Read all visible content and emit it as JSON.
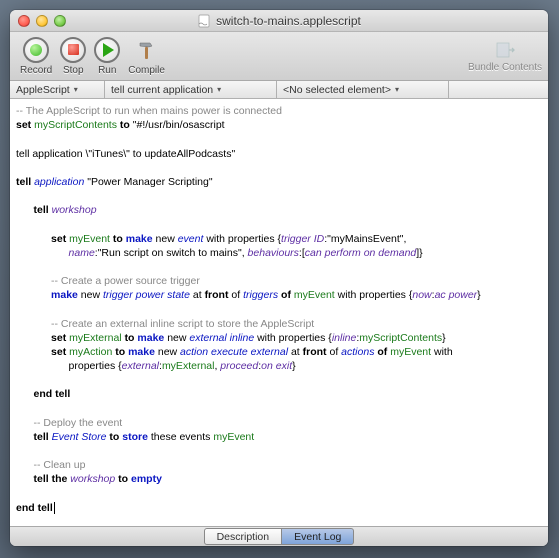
{
  "window": {
    "title": "switch-to-mains.applescript"
  },
  "toolbar": {
    "record": "Record",
    "stop": "Stop",
    "run": "Run",
    "compile": "Compile",
    "bundle": "Bundle Contents"
  },
  "navbar": {
    "lang": "AppleScript",
    "target": "tell current application",
    "element": "<No selected element>"
  },
  "code": {
    "l1_cmt": "-- The AppleScript to run when mains power is connected",
    "l2_a": "set",
    "l2_b": "myScriptContents",
    "l2_c": "to",
    "l2_d": "\"#!/usr/bin/osascript",
    "l3": "",
    "l4": "tell application \\\"iTunes\\\" to updateAllPodcasts\"",
    "l5": "",
    "l6_a": "tell",
    "l6_b": "application",
    "l6_c": "\"Power Manager Scripting\"",
    "l7": "",
    "l8_a": "tell",
    "l8_b": "workshop",
    "l9": "",
    "l10_a": "set",
    "l10_b": "myEvent",
    "l10_c": "to",
    "l10_d": "make",
    "l10_e": "new",
    "l10_f": "event",
    "l10_g": "with properties",
    "l10_h": "{",
    "l10_i": "trigger ID",
    "l10_j": ":\"myMainsEvent\",",
    "l11_a": "name",
    "l11_b": ":\"Run script on switch to mains\",",
    "l11_c": "behaviours",
    "l11_d": ":[",
    "l11_e": "can perform on demand",
    "l11_f": "]}",
    "l12": "",
    "l13_cmt": "-- Create a power source trigger",
    "l14_a": "make",
    "l14_b": "new",
    "l14_c": "trigger power state",
    "l14_d": "at",
    "l14_e": "front",
    "l14_f": "of",
    "l14_g": "triggers",
    "l14_h": "of",
    "l14_i": "myEvent",
    "l14_j": "with properties",
    "l14_k": "{",
    "l14_l": "now",
    "l14_m": ":",
    "l14_n": "ac power",
    "l14_o": "}",
    "l15": "",
    "l16_cmt": "-- Create an external inline script to store the AppleScript",
    "l17_a": "set",
    "l17_b": "myExternal",
    "l17_c": "to",
    "l17_d": "make",
    "l17_e": "new",
    "l17_f": "external inline",
    "l17_g": "with properties",
    "l17_h": "{",
    "l17_i": "inline",
    "l17_j": ":",
    "l17_k": "myScriptContents",
    "l17_l": "}",
    "l18_a": "set",
    "l18_b": "myAction",
    "l18_c": "to",
    "l18_d": "make",
    "l18_e": "new",
    "l18_f": "action execute external",
    "l18_g": "at",
    "l18_h": "front",
    "l18_i": "of",
    "l18_j": "actions",
    "l18_k": "of",
    "l18_l": "myEvent",
    "l18_m": "with",
    "l19_a": "properties",
    "l19_b": "{",
    "l19_c": "external",
    "l19_d": ":",
    "l19_e": "myExternal",
    "l19_f": ",",
    "l19_g": "proceed",
    "l19_h": ":",
    "l19_i": "on exit",
    "l19_j": "}",
    "l20": "",
    "l21": "end tell",
    "l22": "",
    "l23_cmt": "-- Deploy the event",
    "l24_a": "tell",
    "l24_b": "Event Store",
    "l24_c": "to",
    "l24_d": "store",
    "l24_e": "these events",
    "l24_f": "myEvent",
    "l25": "",
    "l26_cmt": "-- Clean up",
    "l27_a": "tell the",
    "l27_b": "workshop",
    "l27_c": "to",
    "l27_d": "empty",
    "l28": "",
    "l29": "end tell"
  },
  "tabs": {
    "description": "Description",
    "eventlog": "Event Log"
  }
}
